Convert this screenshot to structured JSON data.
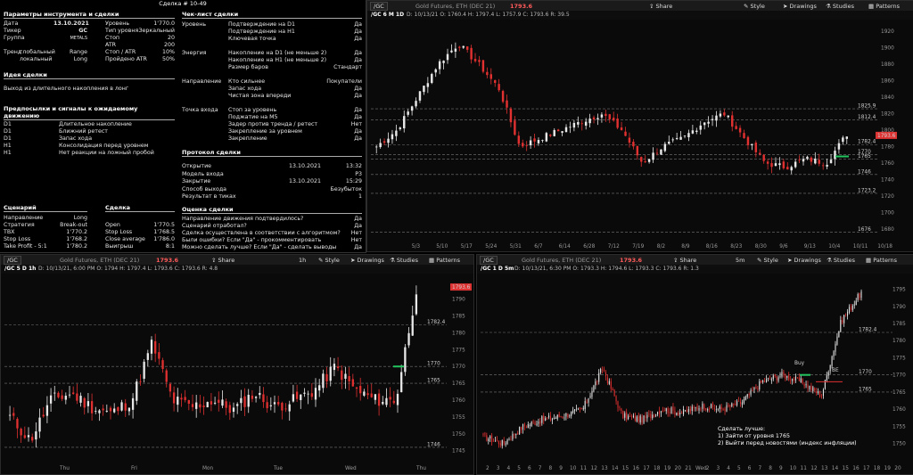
{
  "card": {
    "title": "Сделка # 10-49",
    "params": {
      "header": "Параметры инструмента и сделки",
      "date_label": "Дата",
      "date": "13.10.2021",
      "ticker_label": "Тикер",
      "ticker": "GC",
      "group_label": "Группа",
      "group": "METALS",
      "level_label": "Уровень",
      "level": "1'770.0",
      "level_type_label": "Тип уровня",
      "level_type": "Зеркальный",
      "stop_label": "Стоп",
      "stop": "20",
      "atr_label": "ATR",
      "atr": "200",
      "trend_label": "Тренд",
      "trend_global": "глобальный",
      "trend_global_val": "Range",
      "trend_local": "локальный",
      "trend_local_val": "Long",
      "stop_atr_label": "Стоп / ATR",
      "stop_atr": "10%",
      "passed_atr_label": "Пройдено ATR",
      "passed_atr": "50%"
    },
    "idea": {
      "header": "Идея сделки",
      "text": "Выход из длительного накопления в лонг"
    },
    "signals": {
      "header": "Предпосылки и сигналы к ожидаемому движению",
      "rows": [
        {
          "tf": "D1",
          "text": "Длительное накопление"
        },
        {
          "tf": "D1",
          "text": "Ближний ретест"
        },
        {
          "tf": "D1",
          "text": "Запас хода"
        },
        {
          "tf": "H1",
          "text": "Консолидация перед уровнем"
        },
        {
          "tf": "H1",
          "text": "Нет реакции на ложный пробой"
        }
      ]
    },
    "scenario": {
      "header": "Сценарий",
      "header2": "Сделка",
      "rows": [
        {
          "a": "Направление",
          "b": "Long",
          "c": "",
          "d": ""
        },
        {
          "a": "Стратегия",
          "b": "Break-out",
          "c": "Open",
          "d": "1'770.5"
        },
        {
          "a": "ТВХ",
          "b": "1'770.2",
          "c": "Stop Loss",
          "d": "1'768.5"
        },
        {
          "a": "Stop Loss",
          "b": "1'768.2",
          "c": "Close average",
          "d": "1'786.0"
        },
        {
          "a": "Take Profit - 5:1",
          "b": "1'780.2",
          "c": "Выигрыш",
          "d": "8:1"
        }
      ]
    },
    "checklist": {
      "header": "Чек-лист сделки",
      "groups": [
        {
          "name": "Уровень",
          "items": [
            [
              "Подтверждение на D1",
              "Да"
            ],
            [
              "Подтверждение на H1",
              "Да"
            ],
            [
              "Ключевая точка",
              "Да"
            ]
          ]
        },
        {
          "name": "Энергия",
          "items": [
            [
              "Накопление на D1 (не меньше 2)",
              "Да"
            ],
            [
              "Накопление на H1 (не меньше 2)",
              "Да"
            ],
            [
              "Размер баров",
              "Стандарт"
            ]
          ]
        },
        {
          "name": "Направление",
          "items": [
            [
              "Кто сильнее",
              "Покупатели"
            ],
            [
              "Запас хода",
              "Да"
            ],
            [
              "Чистая зона впереди",
              "Да"
            ]
          ]
        },
        {
          "name": "Точка входа",
          "items": [
            [
              "Стоп за уровень",
              "Да"
            ],
            [
              "Поджатие на M5",
              "Да"
            ],
            [
              "Задер против тренда / ретест",
              "Нет"
            ],
            [
              "Закрепление за уровнем",
              "Да"
            ],
            [
              "Закрепление",
              "Да"
            ]
          ]
        }
      ]
    },
    "protocol": {
      "header": "Протокол сделки",
      "rows": [
        {
          "a": "Открытие",
          "b": "13.10.2021",
          "c": "13:32"
        },
        {
          "a": "Модель входа",
          "b": "",
          "c": "P3"
        },
        {
          "a": "Закрытие",
          "b": "13.10.2021",
          "c": "15:29"
        },
        {
          "a": "Способ выхода",
          "b": "",
          "c": "Безубыток"
        },
        {
          "a": "Результат в тиках",
          "b": "",
          "c": "1"
        }
      ]
    },
    "evaluation": {
      "header": "Оценка сделки",
      "rows": [
        [
          "Направление движения подтвердилось?",
          "Да"
        ],
        [
          "Сценарий отработал?",
          "Да"
        ],
        [
          "Сделка осуществлена в соответствии с алгоритмом?",
          "Нет"
        ],
        [
          "Были ошибки? Если \"Да\" - прокомментировать",
          "Нет"
        ],
        [
          "Можно сделать лучше? Если \"Да\" - сделать выводы",
          "Да"
        ]
      ]
    }
  },
  "toolbar": {
    "share": "Share",
    "style": "Style",
    "drawings": "Drawings",
    "studies": "Studies",
    "patterns": "Patterns",
    "symbol": "/GC",
    "desc": "Gold Futures, ETH (DEC 21)",
    "last": "1793.6"
  },
  "panes": {
    "daily": {
      "info": "/GC 6 M 1D",
      "ohlc": "D: 10/13/21   O: 1760.4   H: 1797.4   L: 1757.9   C: 1793.6   R: 39.5",
      "levels": [
        "1825.9",
        "1812.4",
        "1782.4",
        "1770",
        "1765",
        "1746",
        "1723.2",
        "1676"
      ],
      "price_badge": "1793.6",
      "y_ticks": [
        "1920",
        "1900",
        "1880",
        "1860",
        "1840",
        "1820",
        "1800",
        "1780",
        "1760",
        "1740",
        "1720",
        "1700",
        "1680"
      ],
      "x_ticks": [
        "5/3",
        "5/10",
        "5/17",
        "5/24",
        "5/31",
        "6/7",
        "6/14",
        "6/28",
        "7/12",
        "7/19",
        "8/2",
        "8/9",
        "8/16",
        "8/23",
        "8/30",
        "9/6",
        "9/13",
        "10/4",
        "10/11",
        "10/18"
      ]
    },
    "hourly": {
      "tf": "1h",
      "info": "/GC 5 D 1h",
      "ohlc": "D: 10/13/21, 6:00 PM   O: 1794   H: 1797.4   L: 1793.6   C: 1793.6   R: 4.8",
      "levels": [
        "1782.4",
        "1770",
        "1765",
        "1746"
      ],
      "price_badge": "1793.6",
      "y_ticks": [
        "1790",
        "1785",
        "1780",
        "1775",
        "1770",
        "1765",
        "1760",
        "1755",
        "1750",
        "1745"
      ],
      "x_ticks": [
        "Thu",
        "Fri",
        "Mon",
        "Tue",
        "Wed",
        "Thu"
      ]
    },
    "m5": {
      "tf": "5m",
      "info": "/GC 1 D 5m",
      "ohlc": "D: 10/13/21, 6:30 PM   O: 1793.3   H: 1794.6   L: 1793.3   C: 1793.6   R: 1.3",
      "levels": [
        "1782.4",
        "1770",
        "1765"
      ],
      "y_ticks": [
        "1795",
        "1790",
        "1785",
        "1780",
        "1775",
        "1770",
        "1765",
        "1760",
        "1755",
        "1750"
      ],
      "x_ticks": [
        "2",
        "3",
        "4",
        "5",
        "6",
        "7",
        "8",
        "9",
        "10",
        "11",
        "12",
        "13",
        "14",
        "15",
        "16",
        "17",
        "18",
        "19",
        "20",
        "21",
        "Wed",
        "2",
        "3",
        "4",
        "5",
        "6",
        "7",
        "8",
        "9",
        "10",
        "11",
        "12",
        "13",
        "14",
        "15",
        "16",
        "17",
        "18",
        "19",
        "20"
      ],
      "buy_label": "Buy",
      "be_label": "BE",
      "note_title": "Сделать лучше:",
      "note_1": "1) Зайти от уровня 1765",
      "note_2": "2) Выйти перед новостями (индекс инфляции)"
    }
  },
  "colors": {
    "up": "#e8e8e8",
    "down": "#e03030",
    "level": "#8a8a8a",
    "accent": "#d33"
  }
}
